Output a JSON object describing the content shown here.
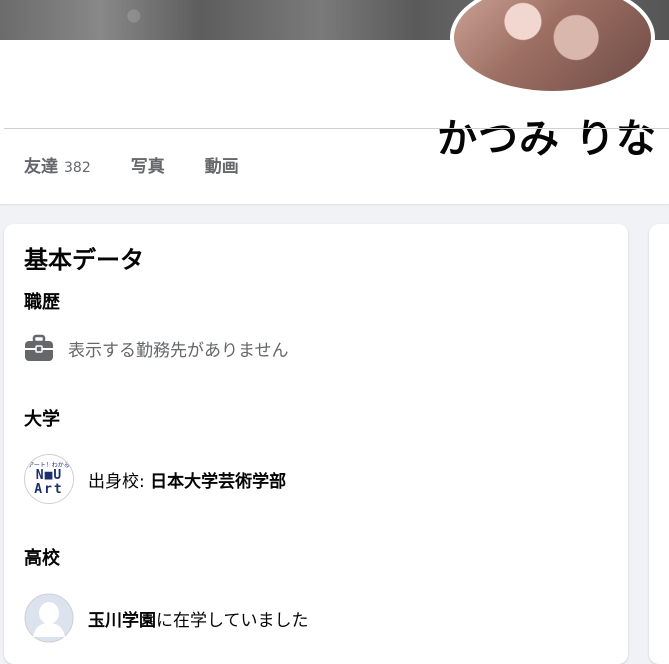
{
  "profile": {
    "name": "かつみ りな"
  },
  "tabs": [
    {
      "label": "友達",
      "count": "382"
    },
    {
      "label": "写真"
    },
    {
      "label": "動画"
    }
  ],
  "basic_info": {
    "title": "基本データ",
    "work": {
      "title": "職歴",
      "empty_text": "表示する勤務先がありません",
      "icon": "briefcase-icon"
    },
    "university": {
      "title": "大学",
      "prefix": "出身校: ",
      "school": "日本大学芸術学部",
      "logo_top": "アート！わかる",
      "logo_mid": "N■U",
      "logo_bot": "Art"
    },
    "high_school": {
      "title": "高校",
      "school": "玉川学園",
      "suffix": "に在学していました",
      "icon": "default-avatar-icon"
    }
  },
  "colors": {
    "text_primary": "#050505",
    "text_secondary": "#65676b",
    "page_bg": "#f0f2f5"
  }
}
